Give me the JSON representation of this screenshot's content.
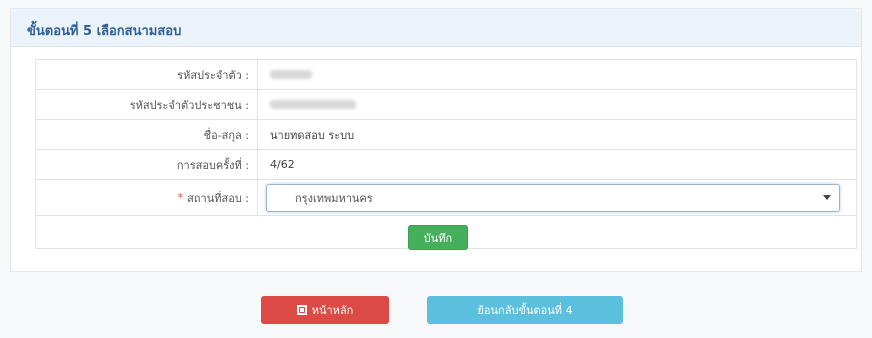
{
  "panel": {
    "heading": "ขั้นตอนที่ 5 เลือกสนามสอบ"
  },
  "form": {
    "rows": [
      {
        "label": "รหัสประจำตัว :",
        "value": ""
      },
      {
        "label": "รหัสประจำตัวประชาชน :",
        "value": ""
      },
      {
        "label": "ชื่อ-สกุล :",
        "value": "นายทดสอบ ระบบ"
      },
      {
        "label": "การสอบครั้งที่ :",
        "value": "4/62"
      },
      {
        "label": "สถานที่สอบ :",
        "value": "กรุงเทพมหานคร",
        "required_mark": "*"
      }
    ],
    "save_label": "บันทึก"
  },
  "footer": {
    "home_label": "หน้าหลัก",
    "back_label": "ย้อนกลับขั้นตอนที่ 4"
  },
  "icons": {
    "home": "home-icon",
    "dropdown": "caret-down-icon"
  },
  "colors": {
    "heading_text": "#2f5f95",
    "save": "#45b05c",
    "home": "#dc4a45",
    "back": "#5bc0de",
    "required": "#d9534f"
  }
}
